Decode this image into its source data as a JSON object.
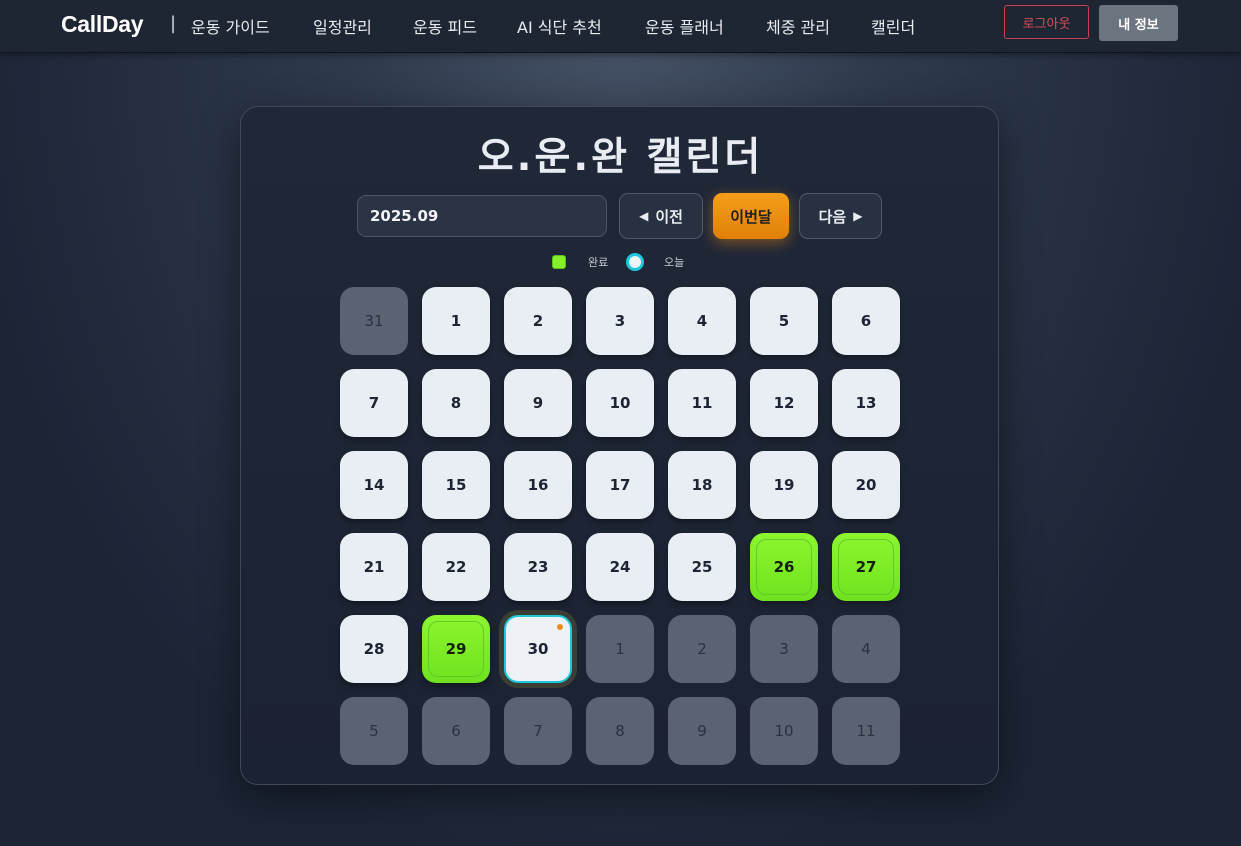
{
  "brand": "CallDay",
  "separator": "|",
  "nav": [
    "운동 가이드",
    "일정관리",
    "운동 피드",
    "AI 식단 추천",
    "운동 플래너",
    "체중 관리",
    "캘린더"
  ],
  "auth": {
    "logout_label": "로그아웃",
    "profile_label": "내 정보"
  },
  "calendar": {
    "title": "오.운.완 캘린더",
    "month_value": "2025.09",
    "prev_label": "이전",
    "this_month_label": "이번달",
    "next_label": "다음",
    "legend": {
      "done_label": "완료",
      "today_label": "오늘"
    },
    "colors": {
      "done": "#86f02a",
      "today_ring": "#1fc7dd",
      "this_month_button": "#f0900f",
      "today_marker": "#f08a16"
    },
    "days": [
      {
        "d": "31",
        "type": "other"
      },
      {
        "d": "1",
        "type": "cur"
      },
      {
        "d": "2",
        "type": "cur"
      },
      {
        "d": "3",
        "type": "cur"
      },
      {
        "d": "4",
        "type": "cur"
      },
      {
        "d": "5",
        "type": "cur"
      },
      {
        "d": "6",
        "type": "cur"
      },
      {
        "d": "7",
        "type": "cur"
      },
      {
        "d": "8",
        "type": "cur"
      },
      {
        "d": "9",
        "type": "cur"
      },
      {
        "d": "10",
        "type": "cur"
      },
      {
        "d": "11",
        "type": "cur"
      },
      {
        "d": "12",
        "type": "cur"
      },
      {
        "d": "13",
        "type": "cur"
      },
      {
        "d": "14",
        "type": "cur"
      },
      {
        "d": "15",
        "type": "cur"
      },
      {
        "d": "16",
        "type": "cur"
      },
      {
        "d": "17",
        "type": "cur"
      },
      {
        "d": "18",
        "type": "cur"
      },
      {
        "d": "19",
        "type": "cur"
      },
      {
        "d": "20",
        "type": "cur"
      },
      {
        "d": "21",
        "type": "cur"
      },
      {
        "d": "22",
        "type": "cur"
      },
      {
        "d": "23",
        "type": "cur"
      },
      {
        "d": "24",
        "type": "cur"
      },
      {
        "d": "25",
        "type": "cur"
      },
      {
        "d": "26",
        "type": "done"
      },
      {
        "d": "27",
        "type": "done"
      },
      {
        "d": "28",
        "type": "cur"
      },
      {
        "d": "29",
        "type": "done"
      },
      {
        "d": "30",
        "type": "today"
      },
      {
        "d": "1",
        "type": "other"
      },
      {
        "d": "2",
        "type": "other"
      },
      {
        "d": "3",
        "type": "other"
      },
      {
        "d": "4",
        "type": "other"
      },
      {
        "d": "5",
        "type": "other"
      },
      {
        "d": "6",
        "type": "other"
      },
      {
        "d": "7",
        "type": "other"
      },
      {
        "d": "8",
        "type": "other"
      },
      {
        "d": "9",
        "type": "other"
      },
      {
        "d": "10",
        "type": "other"
      },
      {
        "d": "11",
        "type": "other"
      }
    ]
  }
}
